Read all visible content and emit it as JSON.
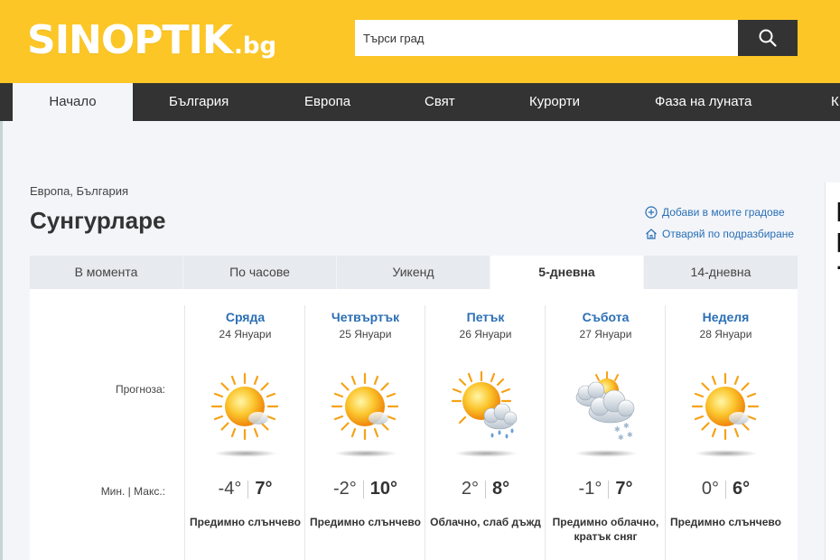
{
  "header": {
    "logo_main": "SINOPTIK",
    "logo_tld": ".bg",
    "search_placeholder": "Търси град",
    "search_icon": "search-icon",
    "bg_color": "#fcc626"
  },
  "nav": {
    "items": [
      {
        "label": "Начало",
        "active": true
      },
      {
        "label": "България"
      },
      {
        "label": "Европа"
      },
      {
        "label": "Свят"
      },
      {
        "label": "Курорти"
      },
      {
        "label": "Фаза на луната"
      },
      {
        "label": "К"
      }
    ]
  },
  "location": {
    "breadcrumb": "Европа, България",
    "city": "Сунгурларе",
    "add_label": "Добави в моите градове",
    "default_label": "Отваряй по подразбиране"
  },
  "tabs": [
    {
      "label": "В момента"
    },
    {
      "label": "По часове"
    },
    {
      "label": "Уикенд"
    },
    {
      "label": "5-дневна",
      "active": true
    },
    {
      "label": "14-дневна"
    }
  ],
  "forecast": {
    "label_forecast": "Прогноза:",
    "label_minmax": "Мин. | Макс.:",
    "days": [
      {
        "name": "Сряда",
        "date": "24 Януари",
        "icon": "mostly-sunny-icon",
        "min": "-4°",
        "max": "7°",
        "desc": "Предимно слънчево"
      },
      {
        "name": "Четвъртък",
        "date": "25 Януари",
        "icon": "mostly-sunny-icon",
        "min": "-2°",
        "max": "10°",
        "desc": "Предимно слънчево"
      },
      {
        "name": "Петък",
        "date": "26 Януари",
        "icon": "cloudy-light-rain-icon",
        "min": "2°",
        "max": "8°",
        "desc": "Облачно, слаб дъжд"
      },
      {
        "name": "Събота",
        "date": "27 Януари",
        "icon": "mostly-cloudy-snow-icon",
        "min": "-1°",
        "max": "7°",
        "desc": "Предимно облачно, кратък сняг"
      },
      {
        "name": "Неделя",
        "date": "28 Януари",
        "icon": "mostly-sunny-icon",
        "min": "0°",
        "max": "6°",
        "desc": "Предимно слънчево"
      }
    ]
  },
  "colors": {
    "accent_yellow": "#fcc626",
    "nav_dark": "#333333",
    "link_blue": "#2a6fb5",
    "page_bg": "#f3f5f9"
  }
}
